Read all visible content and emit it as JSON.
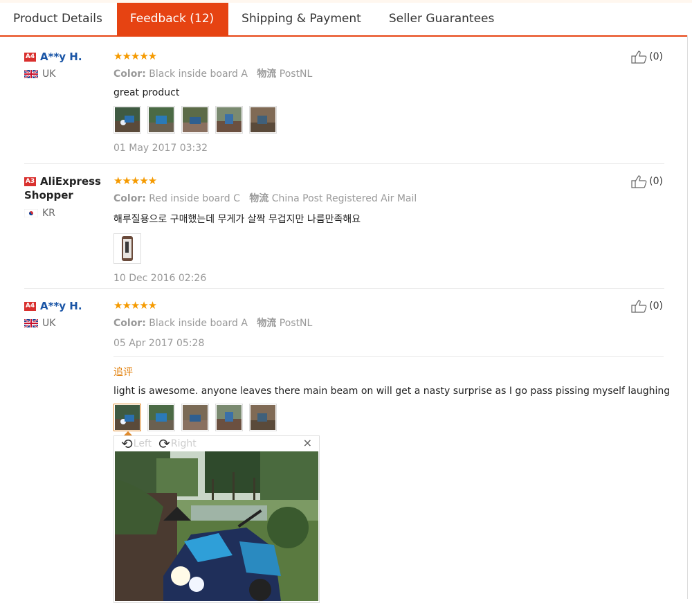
{
  "tabs": [
    {
      "label": "Product Details"
    },
    {
      "label": "Feedback (12)"
    },
    {
      "label": "Shipping & Payment"
    },
    {
      "label": "Seller Guarantees"
    }
  ],
  "reviews": [
    {
      "level": "A4",
      "name": "A**y H.",
      "country": "UK",
      "stars": "★★★★★",
      "color_label": "Color:",
      "color_value": "Black inside board A",
      "logistics_label": "物流",
      "logistics_value": "PostNL",
      "text": "great product",
      "date": "01 May 2017 03:32",
      "likes": "(0)"
    },
    {
      "level": "A3",
      "name_line1": "AliExpress",
      "name_line2": "Shopper",
      "country": "KR",
      "stars": "★★★★★",
      "color_label": "Color:",
      "color_value": "Red inside board C",
      "logistics_label": "物流",
      "logistics_value": "China Post Registered Air Mail",
      "text": "해루질용으로 구매했는데 무게가 살짝 무겁지만 나름만족해요",
      "date": "10 Dec 2016 02:26",
      "likes": "(0)"
    },
    {
      "level": "A4",
      "name": "A**y H.",
      "country": "UK",
      "stars": "★★★★★",
      "color_label": "Color:",
      "color_value": "Black inside board A",
      "logistics_label": "物流",
      "logistics_value": "PostNL",
      "date": "05 Apr 2017 05:28",
      "likes": "(0)",
      "followup_label": "追评",
      "followup_text": "light is awesome. anyone leaves there main beam on will get a nasty surprise as I go pass pissing myself laughing"
    }
  ],
  "viewer": {
    "rotate_left": "Left",
    "rotate_right": "Right",
    "close": "×"
  },
  "colors": {
    "accent": "#e64312",
    "stars": "#f59a00",
    "link": "#1a55a6"
  }
}
